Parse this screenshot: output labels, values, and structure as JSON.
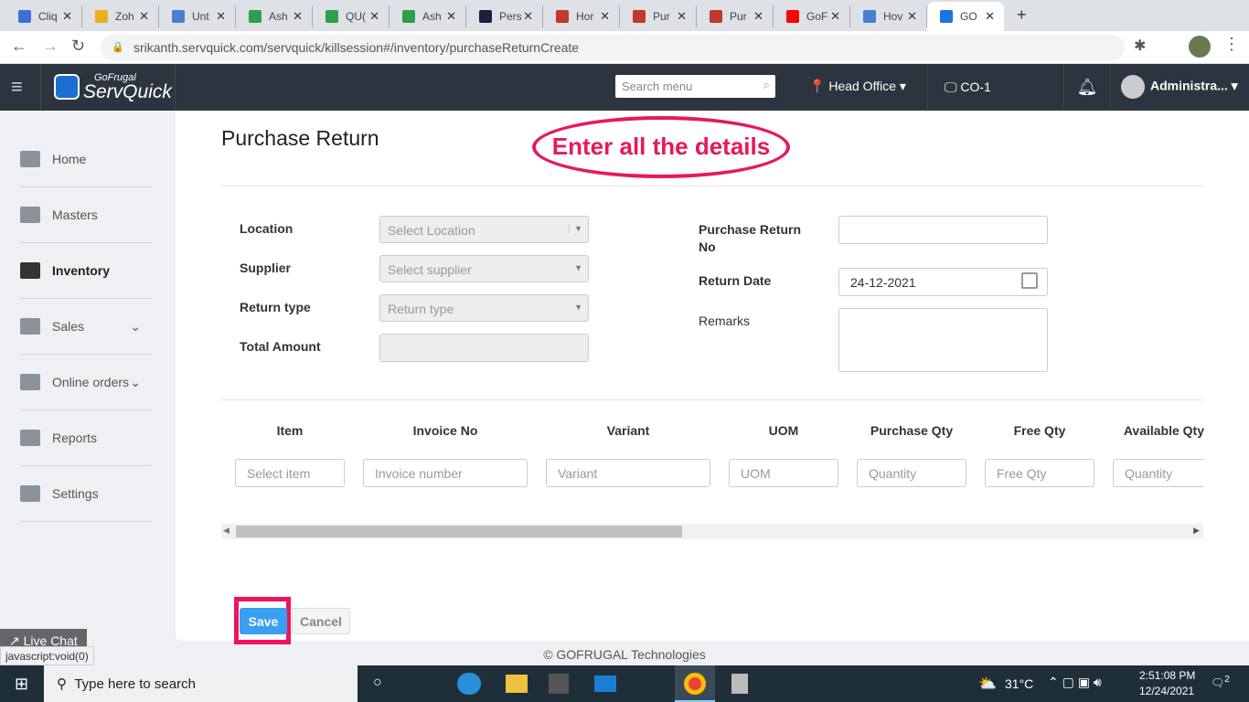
{
  "browser": {
    "tabs": [
      "Cliq",
      "Zoh",
      "Unt",
      "Ash",
      "QU(",
      "Ash",
      "Pers",
      "Hor",
      "Pur",
      "Pur",
      "GoF",
      "Hov",
      "GO"
    ],
    "tab_colors": [
      "#3b6fd8",
      "#e8b020",
      "#4a7fd0",
      "#2ea04a",
      "#2ea04a",
      "#2ea04a",
      "#1a2040",
      "#c0392b",
      "#c0392b",
      "#c0392b",
      "#ff0000",
      "#4a7fd0",
      "#1a73e8"
    ],
    "url": "srikanth.servquick.com/servquick/killsession#/inventory/purchaseReturnCreate"
  },
  "app": {
    "brand_small": "GoFrugal",
    "brand": "ServQuick",
    "search_placeholder": "Search menu",
    "location": "Head Office",
    "counter": "CO-1",
    "user": "Administra..."
  },
  "sidebar": [
    {
      "label": "Home"
    },
    {
      "label": "Masters"
    },
    {
      "label": "Inventory"
    },
    {
      "label": "Sales"
    },
    {
      "label": "Online orders"
    },
    {
      "label": "Reports"
    },
    {
      "label": "Settings"
    }
  ],
  "page": {
    "title": "Purchase Return",
    "annotation": "Enter all the details"
  },
  "form": {
    "location_label": "Location",
    "location_placeholder": "Select Location",
    "supplier_label": "Supplier",
    "supplier_placeholder": "Select supplier",
    "return_type_label": "Return type",
    "return_type_placeholder": "Return type",
    "total_label": "Total Amount",
    "total_value": "",
    "pr_no_label": "Purchase Return No",
    "pr_no_value": "",
    "return_date_label": "Return Date",
    "return_date_value": "24-12-2021",
    "remarks_label": "Remarks",
    "remarks_value": ""
  },
  "table": {
    "headers": [
      "Item",
      "Invoice No",
      "Variant",
      "UOM",
      "Purchase Qty",
      "Free Qty",
      "Available Qty"
    ],
    "placeholders": [
      "Select item",
      "Invoice number",
      "Variant",
      "UOM",
      "Quantity",
      "Free Qty",
      "Quantity"
    ]
  },
  "buttons": {
    "save": "Save",
    "cancel": "Cancel"
  },
  "footer": "© GOFRUGAL Technologies",
  "live_chat": "Live Chat",
  "status_url": "javascript:void(0)",
  "taskbar": {
    "search": "Type here to search",
    "temp": "31°C",
    "time": "2:51:08 PM",
    "date": "12/24/2021",
    "notifications": "2"
  }
}
